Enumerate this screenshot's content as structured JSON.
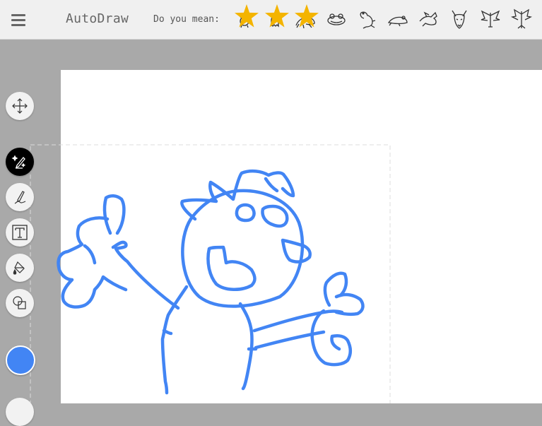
{
  "header": {
    "app_title": "AutoDraw",
    "suggestion_label": "Do you mean:",
    "suggestions": [
      {
        "name": "cartoon-creature",
        "starred": true
      },
      {
        "name": "cartoon-ghost",
        "starred": true
      },
      {
        "name": "frog",
        "starred": true
      },
      {
        "name": "frog-face",
        "starred": false
      },
      {
        "name": "frog-sitting",
        "starred": false
      },
      {
        "name": "frog-jumping",
        "starred": false
      },
      {
        "name": "dragon",
        "starred": false
      },
      {
        "name": "dragon-head",
        "starred": false
      },
      {
        "name": "dragon-winged",
        "starred": false
      },
      {
        "name": "dragon-flying",
        "starred": false
      }
    ]
  },
  "tools": [
    {
      "name": "move-tool",
      "icon": "move-icon"
    },
    {
      "name": "autodraw-tool",
      "icon": "magic-pen-icon",
      "active": true
    },
    {
      "name": "draw-tool",
      "icon": "pencil-icon"
    },
    {
      "name": "type-tool",
      "icon": "text-icon"
    },
    {
      "name": "fill-tool",
      "icon": "paint-bucket-icon"
    },
    {
      "name": "shape-tool",
      "icon": "shapes-icon"
    }
  ],
  "colors": {
    "stroke": "#4285f4",
    "selected_color": "#4285f4",
    "star": "#f4b400",
    "toolbar_bg": "#f0f0f0",
    "workspace_bg": "#a9a9a9"
  }
}
